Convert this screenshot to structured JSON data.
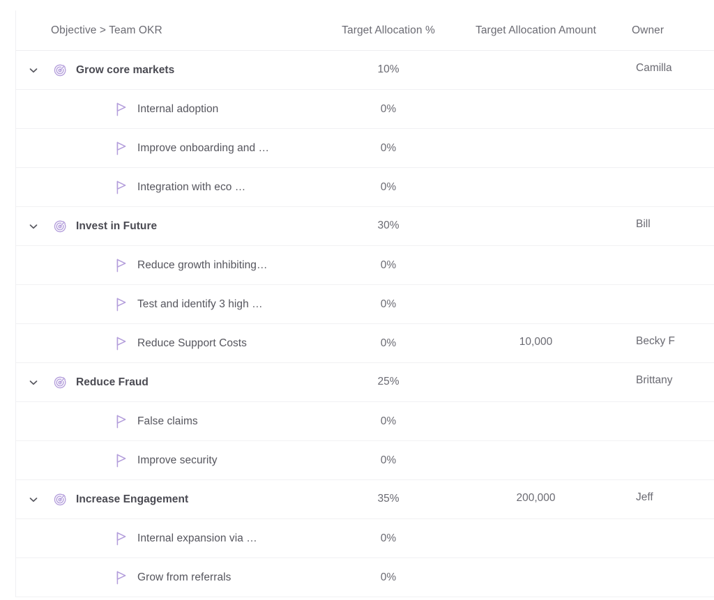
{
  "table": {
    "columns": [
      {
        "key": "objective",
        "label": "Objective > Team OKR"
      },
      {
        "key": "target_pct",
        "label": "Target Allocation %"
      },
      {
        "key": "target_amount",
        "label": "Target Allocation Amount"
      },
      {
        "key": "owner",
        "label": "Owner"
      }
    ],
    "icons": {
      "objective": "target-icon",
      "key_result": "flag-icon",
      "expand": "chevron-down-icon"
    },
    "colors": {
      "icon_purple": "#b39ddb",
      "objective_text": "#4a4a52",
      "body_text": "#6a6a72",
      "header_text": "#6b6b73",
      "row_border": "#f1f1f3"
    },
    "rows": [
      {
        "type": "objective",
        "expanded": true,
        "name": "Grow core markets",
        "target_pct": "10%",
        "target_amount": "",
        "owner": "Camilla"
      },
      {
        "type": "key_result",
        "name": "Internal adoption",
        "target_pct": "0%",
        "target_amount": "",
        "owner": ""
      },
      {
        "type": "key_result",
        "name": "Improve onboarding and …",
        "target_pct": "0%",
        "target_amount": "",
        "owner": ""
      },
      {
        "type": "key_result",
        "name": "Integration with eco …",
        "target_pct": "0%",
        "target_amount": "",
        "owner": ""
      },
      {
        "type": "objective",
        "expanded": true,
        "name": "Invest in Future",
        "target_pct": "30%",
        "target_amount": "",
        "owner": "Bill"
      },
      {
        "type": "key_result",
        "name": "Reduce growth inhibiting…",
        "target_pct": "0%",
        "target_amount": "",
        "owner": ""
      },
      {
        "type": "key_result",
        "name": "Test and identify 3 high …",
        "target_pct": "0%",
        "target_amount": "",
        "owner": ""
      },
      {
        "type": "key_result",
        "name": "Reduce Support Costs",
        "target_pct": "0%",
        "target_amount": "10,000",
        "owner": "Becky F"
      },
      {
        "type": "objective",
        "expanded": true,
        "name": "Reduce Fraud",
        "target_pct": "25%",
        "target_amount": "",
        "owner": "Brittany"
      },
      {
        "type": "key_result",
        "name": "False claims",
        "target_pct": "0%",
        "target_amount": "",
        "owner": ""
      },
      {
        "type": "key_result",
        "name": "Improve security",
        "target_pct": "0%",
        "target_amount": "",
        "owner": ""
      },
      {
        "type": "objective",
        "expanded": true,
        "name": "Increase Engagement",
        "target_pct": "35%",
        "target_amount": "200,000",
        "owner": "Jeff"
      },
      {
        "type": "key_result",
        "name": "Internal expansion via …",
        "target_pct": "0%",
        "target_amount": "",
        "owner": ""
      },
      {
        "type": "key_result",
        "name": "Grow from referrals",
        "target_pct": "0%",
        "target_amount": "",
        "owner": ""
      }
    ]
  }
}
